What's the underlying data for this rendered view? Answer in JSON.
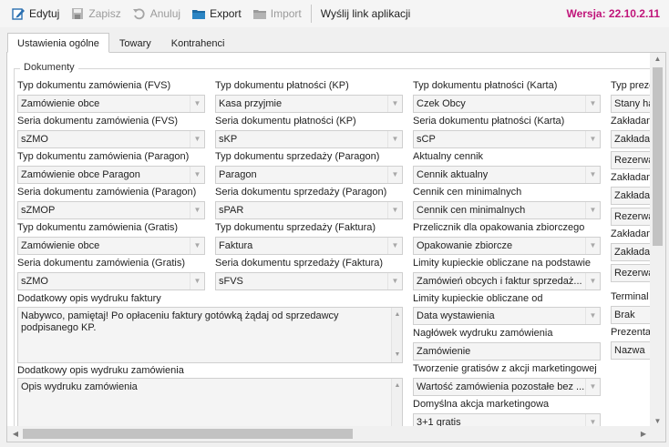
{
  "toolbar": {
    "edit": "Edytuj",
    "save": "Zapisz",
    "cancel": "Anuluj",
    "export": "Export",
    "import": "Import",
    "send_link": "Wyślij link aplikacji",
    "version": "Wersja: 22.10.2.11"
  },
  "tabs": [
    "Ustawienia ogólne",
    "Towary",
    "Kontrahenci"
  ],
  "group_title": "Dokumenty",
  "col1": [
    {
      "label": "Typ dokumentu zamówienia (FVS)",
      "value": "Zamówienie obce"
    },
    {
      "label": "Seria dokumentu zamówienia (FVS)",
      "value": "sZMO"
    },
    {
      "label": "Typ dokumentu zamówienia (Paragon)",
      "value": "Zamówienie obce Paragon"
    },
    {
      "label": "Seria dokumentu zamówienia (Paragon)",
      "value": "sZMOP"
    },
    {
      "label": "Typ dokumentu zamówienia (Gratis)",
      "value": "Zamówienie obce"
    },
    {
      "label": "Seria dokumentu zamówienia (Gratis)",
      "value": "sZMO"
    }
  ],
  "col2": [
    {
      "label": "Typ dokumentu płatności (KP)",
      "value": "Kasa przyjmie"
    },
    {
      "label": "Seria dokumentu płatności (KP)",
      "value": "sKP"
    },
    {
      "label": "Typ dokumentu sprzedaży (Paragon)",
      "value": "Paragon"
    },
    {
      "label": "Seria dokumentu sprzedaży (Paragon)",
      "value": "sPAR"
    },
    {
      "label": "Typ dokumentu sprzedaży (Faktura)",
      "value": "Faktura"
    },
    {
      "label": "Seria dokumentu sprzedaży (Faktura)",
      "value": "sFVS"
    }
  ],
  "col3": [
    {
      "label": "Typ dokumentu płatności (Karta)",
      "value": "Czek Obcy"
    },
    {
      "label": "Seria dokumentu płatności (Karta)",
      "value": "sCP"
    },
    {
      "label": "Aktualny cennik",
      "value": "Cennik aktualny"
    },
    {
      "label": "Cennik cen minimalnych",
      "value": "Cennik cen minimalnych"
    },
    {
      "label": "Przelicznik dla opakowania zbiorczego",
      "value": "Opakowanie zbiorcze"
    },
    {
      "label": "Limity kupieckie obliczane na podstawie",
      "value": "Zamówień obcych i faktur sprzedaż..."
    },
    {
      "label": "Limity kupieckie obliczane od",
      "value": "Data wystawienia"
    },
    {
      "label": "Nagłówek wydruku zamówienia",
      "value": "Zamówienie"
    },
    {
      "label": "Tworzenie gratisów z akcji marketingowej",
      "value": "Wartość zamówienia pozostałe bez ..."
    },
    {
      "label": "Domyślna akcja marketingowa",
      "value": "3+1 gratis"
    }
  ],
  "col4": {
    "labels": [
      "Typ prezen",
      "Zakładan",
      "Zakładan",
      "Zakładan",
      "Terminal",
      "Prezenta"
    ],
    "values": [
      "Stany ha",
      "Zakłada",
      "Rezerwa",
      "Zakłada",
      "Rezerwa",
      "Zakłada",
      "Rezerwa",
      "Brak",
      "Nazwa"
    ]
  },
  "invoice_note": {
    "label": "Dodatkowy opis wydruku faktury",
    "value": "Nabywco, pamiętaj! Po opłaceniu faktury gotówką żądaj od sprzedawcy podpisanego KP."
  },
  "order_note": {
    "label": "Dodatkowy opis wydruku zamówienia",
    "value": "Opis wydruku zamówienia"
  }
}
